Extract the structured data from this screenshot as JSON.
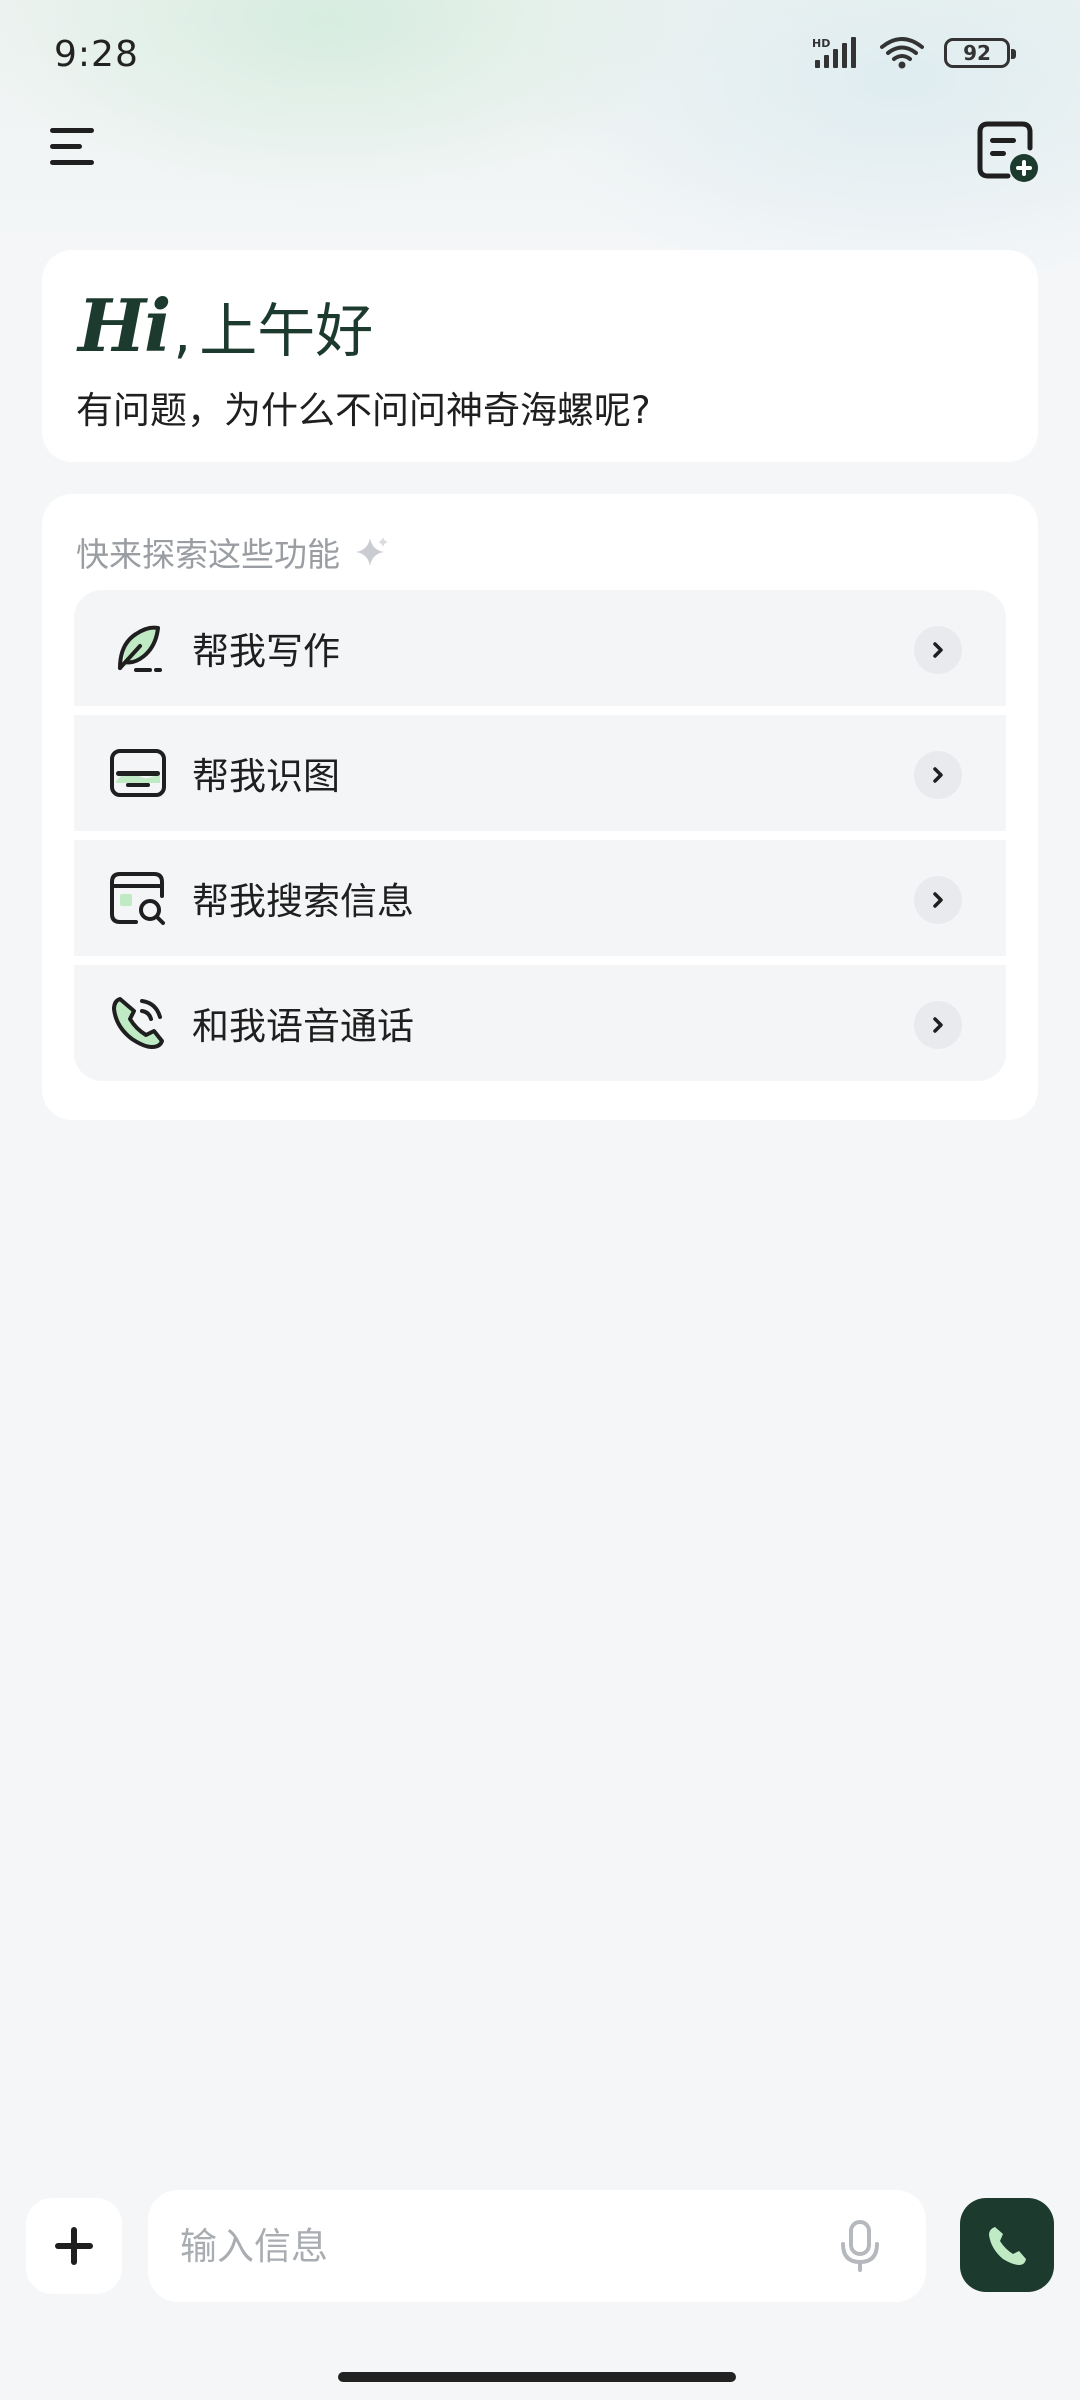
{
  "status_bar": {
    "time": "9:28",
    "network": "HD",
    "battery": "92"
  },
  "top_bar": {
    "menu_icon": "hamburger-menu-icon",
    "new_chat_icon": "new-chat-icon"
  },
  "greeting": {
    "hi": "Hi",
    "comma": ",",
    "time_of_day": "上午好",
    "subtitle": "有问题，为什么不问问神奇海螺呢?"
  },
  "explore": {
    "title": "快来探索这些功能",
    "sparkle_icon": "sparkle-icon",
    "items": [
      {
        "label": "帮我写作",
        "icon": "quill-icon"
      },
      {
        "label": "帮我识图",
        "icon": "image-recognize-icon"
      },
      {
        "label": "帮我搜索信息",
        "icon": "web-search-icon"
      },
      {
        "label": "和我语音通话",
        "icon": "voice-call-icon"
      }
    ]
  },
  "composer": {
    "placeholder": "输入信息",
    "plus_icon": "plus-icon",
    "mic_icon": "microphone-icon",
    "call_icon": "phone-icon"
  },
  "colors": {
    "brand": "#1c3a2d",
    "accent_green": "#bfeac4",
    "background": "#f4f6f8",
    "card": "#ffffff",
    "feature_row": "#f4f5f7",
    "muted_text": "#9a9ea3"
  }
}
